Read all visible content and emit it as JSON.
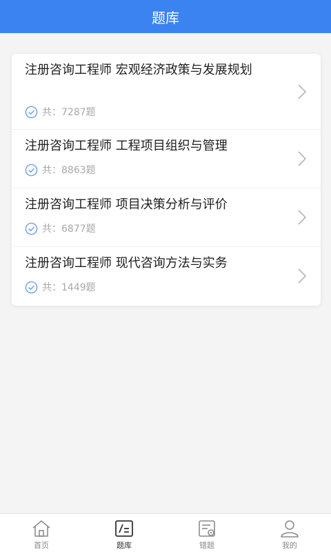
{
  "header": {
    "title": "题库"
  },
  "list": {
    "items": [
      {
        "title": "注册咨询工程师 宏观经济政策与发展规划",
        "prefix": "共：",
        "count": "7287题"
      },
      {
        "title": "注册咨询工程师 工程项目组织与管理",
        "prefix": "共：",
        "count": "8863题"
      },
      {
        "title": "注册咨询工程师 项目决策分析与评价",
        "prefix": "共：",
        "count": "6877题"
      },
      {
        "title": "注册咨询工程师 现代咨询方法与实务",
        "prefix": "共：",
        "count": "1449题"
      }
    ]
  },
  "tabbar": {
    "tabs": [
      {
        "label": "首页",
        "icon": "home-icon"
      },
      {
        "label": "题库",
        "icon": "question-bank-icon",
        "active": true
      },
      {
        "label": "错题",
        "icon": "wrong-questions-icon"
      },
      {
        "label": "我的",
        "icon": "user-icon"
      }
    ]
  },
  "colors": {
    "accent": "#3b83f0",
    "check": "#6d9ee9"
  }
}
